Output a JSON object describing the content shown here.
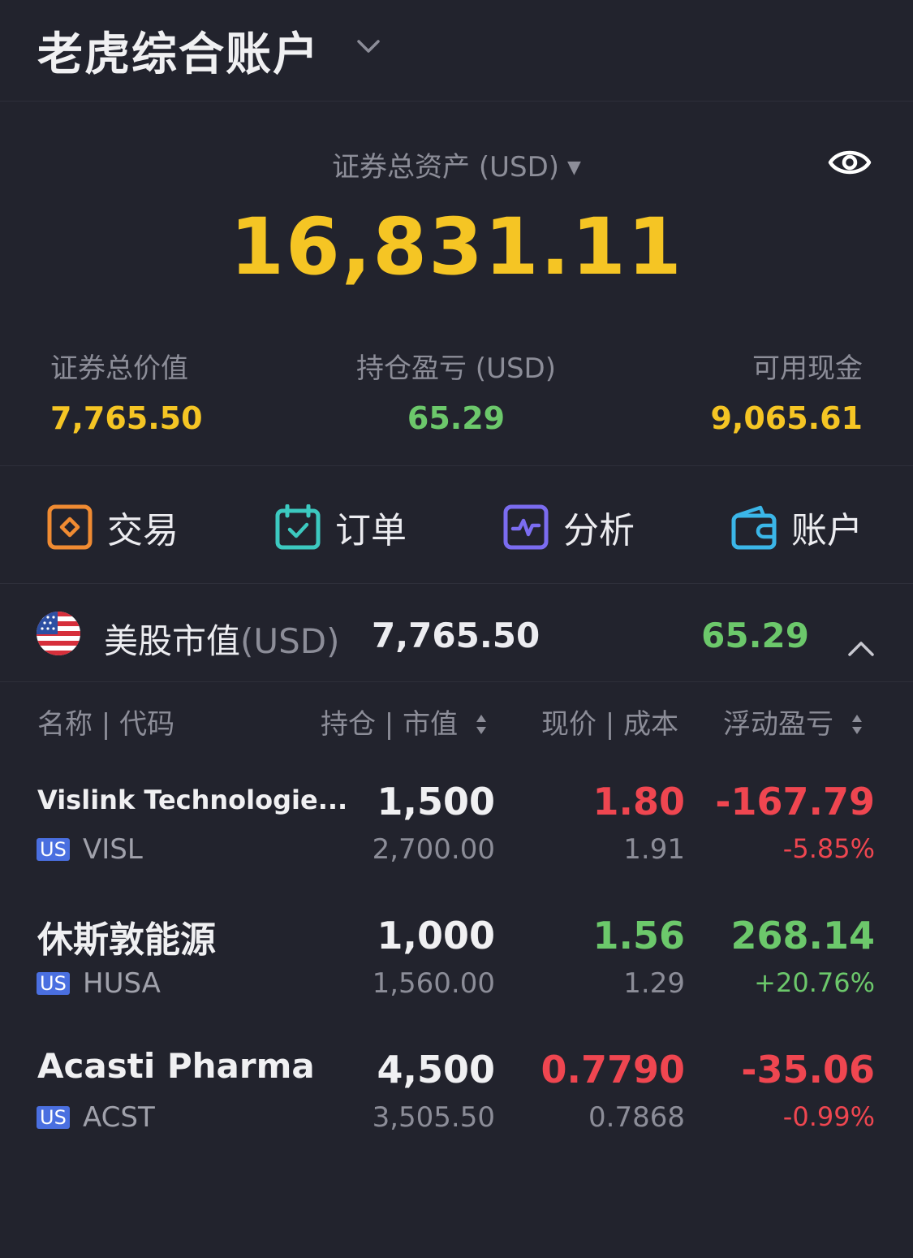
{
  "header": {
    "title": "老虎综合账户"
  },
  "summary": {
    "total_label": "证券总资产 (USD)",
    "total_value": "16,831.11",
    "stats": [
      {
        "label": "证券总价值",
        "value": "7,765.50"
      },
      {
        "label": "持仓盈亏 (USD)",
        "value": "65.29"
      },
      {
        "label": "可用现金",
        "value": "9,065.61"
      }
    ]
  },
  "actions": [
    {
      "label": "交易",
      "icon": "trade-icon",
      "color": "#f08b32"
    },
    {
      "label": "订单",
      "icon": "calendar-check-icon",
      "color": "#3cc9c0"
    },
    {
      "label": "分析",
      "icon": "pulse-chart-icon",
      "color": "#7b6cf0"
    },
    {
      "label": "账户",
      "icon": "wallet-icon",
      "color": "#3bb6e8"
    }
  ],
  "market": {
    "label": "美股市值",
    "currency": "(USD)",
    "value": "7,765.50",
    "pnl": "65.29"
  },
  "columns": {
    "name": "名称 | 代码",
    "holding": "持仓 | 市值",
    "price": "现价 | 成本",
    "pnl": "浮动盈亏"
  },
  "holdings": [
    {
      "name": "Vislink Technologie...",
      "badge": "US",
      "ticker": "VISL",
      "qty": "1,500",
      "market_value": "2,700.00",
      "price": "1.80",
      "cost": "1.91",
      "pnl": "-167.79",
      "pnl_pct": "-5.85%"
    },
    {
      "name": "休斯敦能源",
      "badge": "US",
      "ticker": "HUSA",
      "qty": "1,000",
      "market_value": "1,560.00",
      "price": "1.56",
      "cost": "1.29",
      "pnl": "268.14",
      "pnl_pct": "+20.76%"
    },
    {
      "name": "Acasti Pharma",
      "badge": "US",
      "ticker": "ACST",
      "qty": "4,500",
      "market_value": "3,505.50",
      "price": "0.7790",
      "cost": "0.7868",
      "pnl": "-35.06",
      "pnl_pct": "-0.99%"
    }
  ],
  "colors": {
    "up": "#6cc86b",
    "down": "#ef4650",
    "accent": "#f5c524",
    "background": "#22232d"
  }
}
